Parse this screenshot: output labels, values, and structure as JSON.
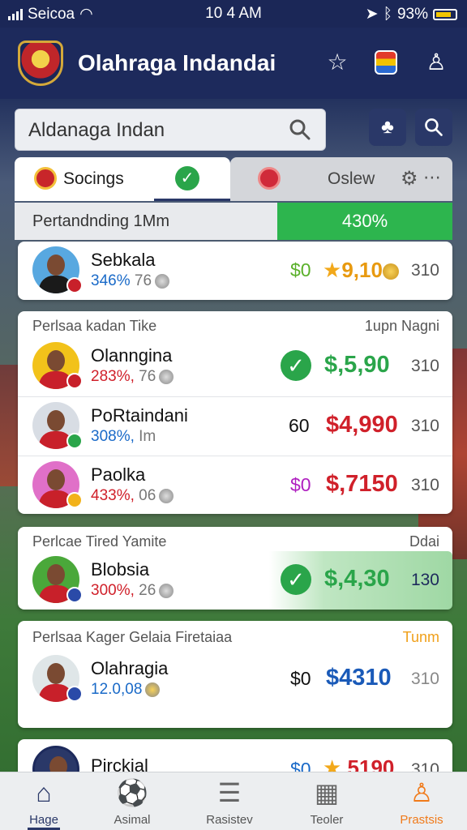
{
  "status_bar": {
    "carrier": "Seicoa",
    "time": "10 4 AM",
    "battery": "93%"
  },
  "header": {
    "title": "Olahraga Indandai"
  },
  "search": {
    "value": "Aldanaga Indan"
  },
  "tabs": [
    {
      "label": "Socings"
    },
    {
      "label": "Oslew"
    }
  ],
  "progress": {
    "label": "Pertandnding 1Mm",
    "value": "430%",
    "fraction": 0.4
  },
  "top_row": {
    "name": "Sebkala",
    "pct": "346%",
    "num": "76",
    "pre": "$0",
    "price": "9,10",
    "count": "310"
  },
  "section1": {
    "title": "Perlsaa kadan Tike",
    "right": "1upn Nagni",
    "rows": [
      {
        "name": "Olanngina",
        "pct": "283%,",
        "num": "76",
        "pre": "",
        "price": "$,5,90",
        "count": "310"
      },
      {
        "name": "PoRtaindani",
        "pct": "308%,",
        "num": "Im",
        "pre": "60",
        "price": "$4,990",
        "count": "310"
      },
      {
        "name": "Paolka",
        "pct": "433%,",
        "num": "06",
        "pre": "$0",
        "price": "$,7150",
        "count": "310"
      }
    ]
  },
  "section2": {
    "title": "Perlcae Tired Yamite",
    "right": "Ddai",
    "row": {
      "name": "Blobsia",
      "pct": "300%,",
      "num": "26",
      "price": "$,4,30",
      "count": "130"
    }
  },
  "section3": {
    "title": "Perlsaa Kager Gelaia Firetaiaa",
    "right": "Tunm",
    "row": {
      "name": "Olahragia",
      "pct": "12.0,08",
      "num": "",
      "pre": "$0",
      "price": "$4310",
      "count": "310"
    }
  },
  "peek_row": {
    "name": "Pirckial",
    "pre": "$0",
    "price": "5190",
    "count": "310"
  },
  "nav": [
    {
      "label": "Hage"
    },
    {
      "label": "Asimal"
    },
    {
      "label": "Rasistev"
    },
    {
      "label": "Teoler"
    },
    {
      "label": "Prastsis"
    }
  ],
  "colors": {
    "navy": "#1d2a5c",
    "green": "#2db54e",
    "red": "#d0202a",
    "blue": "#1a6ac8",
    "orange": "#f07a1a"
  }
}
